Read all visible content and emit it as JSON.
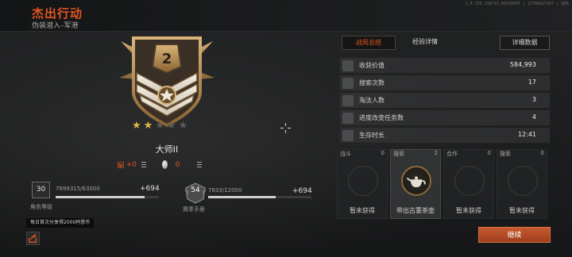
{
  "header": {
    "title": "杰出行动",
    "subtitle": "伪装潜入–军港",
    "build_info": "1.0.135.136713.00250655 | 11789627267 | 远鸣"
  },
  "rank": {
    "number": "2",
    "name": "大师II",
    "stars_filled": 2,
    "stars_total": 5,
    "rank_points": "+0",
    "coins": "0"
  },
  "player_level": {
    "level": "30",
    "label": "角色等级",
    "xp": "7699315/63000",
    "gain": "+694",
    "progress": 0.86
  },
  "season": {
    "level": "54",
    "label": "赛季手册",
    "xp": "7833/12000",
    "gain": "+694",
    "progress": 0.65
  },
  "tip": "每日首次分享得2000柯恩币",
  "tabs": {
    "summary": "战局总结",
    "exp": "经验详情",
    "detail": "详细数据"
  },
  "stats": [
    {
      "label": "收获价值",
      "value": "584,993",
      "icon": "box-icon"
    },
    {
      "label": "搜索次数",
      "value": "17",
      "icon": "search-icon"
    },
    {
      "label": "淘汰人数",
      "value": "3",
      "icon": "people-icon"
    },
    {
      "label": "进度改变任务数",
      "value": "4",
      "icon": "list-icon"
    },
    {
      "label": "生存时长",
      "value": "12:41",
      "icon": "hourglass-icon"
    }
  ],
  "achievements": [
    {
      "category": "战斗",
      "count": "0",
      "caption": "暂未获得"
    },
    {
      "category": "搜索",
      "count": "2",
      "caption": "带出古董茶壶"
    },
    {
      "category": "合作",
      "count": "0",
      "caption": "暂未获得"
    },
    {
      "category": "搜索",
      "count": "0",
      "caption": "暂未获得"
    }
  ],
  "continue_label": "继续",
  "colors": {
    "accent": "#e4551f",
    "gold": "#c8a060"
  }
}
